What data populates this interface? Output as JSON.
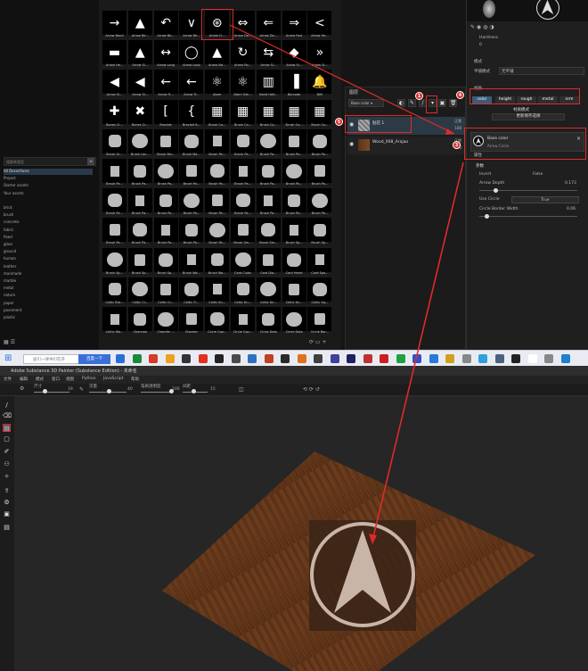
{
  "shelf": {
    "search_placeholder": "搜索库类型",
    "categories": [
      "All Decorfaces",
      "Project",
      "Starter assets",
      "Your assets",
      "",
      "brick",
      "brush",
      "concrete",
      "fabric",
      "fixed",
      "glass",
      "ground",
      "human",
      "leather",
      "manmade",
      "marble",
      "metal",
      "nature",
      "paper",
      "pavement",
      "plastic"
    ]
  },
  "grid": {
    "rows": [
      [
        "Arrow Band",
        "Arrow Be...",
        "Arrow Be...",
        "Arrow Be...",
        "Arrow Ci...",
        "Arrow Do...",
        "Arrow Do...",
        "Arrow Fast",
        "Arrow He..."
      ],
      [
        "Arrow He...",
        "Arrow Si...",
        "Arrow Long",
        "Arrow Loop",
        "Arrow Ne...",
        "Arrow Ro...",
        "Arrow Si...",
        "Arrow Si...",
        "Arrow Si..."
      ],
      [
        "Arrow Si...",
        "Arrow Si...",
        "Arrow Tr...",
        "Arrow Tr...",
        "Atom",
        "Atom Sim...",
        "Band Half...",
        "Barcode",
        "Bell"
      ],
      [
        "Bones Cr...",
        "Bones Cr...",
        "Bracket",
        "Bracket B...",
        "Brush Co...",
        "Brush Co...",
        "Brush Co...",
        "Brush Co...",
        "Brush Co..."
      ],
      [
        "Brush Gr...",
        "Brush Lon...",
        "Brush Ma...",
        "Brush Ma...",
        "Brush Pa...",
        "Brush Pa...",
        "Brush Pa...",
        "Brush Pa...",
        "Brush Pa..."
      ],
      [
        "Brush Pa...",
        "Brush Pa...",
        "Brush Pa...",
        "Brush Pa...",
        "Brush Pa...",
        "Brush Pa...",
        "Brush Pa...",
        "Brush Pa...",
        "Brush Pa..."
      ],
      [
        "Brush Pa...",
        "Brush Pa...",
        "Brush Pa...",
        "Brush Pa...",
        "Brush Pa...",
        "Brush Pa...",
        "Brush Pa...",
        "Brush Pa...",
        "Brush Pa..."
      ],
      [
        "Brush Pa...",
        "Brush Pa...",
        "Brush Pa...",
        "Brush Pa...",
        "Brush Pa...",
        "Brush Sm...",
        "Brush Sm...",
        "Brush Sp...",
        "Brush Sp..."
      ],
      [
        "Brush Sp...",
        "Brush Sp...",
        "Brush Sp...",
        "Brush Wa...",
        "Brush Wa...",
        "Card Clubs",
        "Card Dia...",
        "Card Heart",
        "Card Spa..."
      ],
      [
        "Celtic Bra...",
        "Celtic Cr...",
        "Celtic Cr...",
        "Celtic Fl...",
        "Celtic Kn...",
        "Celtic Kn...",
        "Celtic Kn...",
        "Celtic Kn...",
        "Celtic Sq..."
      ],
      [
        "Celtic Wa...",
        "Charcoal",
        "Chamfer ...",
        "Checker",
        "Circle Cop...",
        "Circle Cop...",
        "Circle Dots",
        "Circle Dots",
        "Circle Bor..."
      ]
    ]
  },
  "layers": {
    "title": "图层",
    "channel_dropdown": "Base color",
    "rows": [
      {
        "name": "贴花 1",
        "blend": "正常",
        "opacity": "100"
      },
      {
        "name": "Wood_008_Arajao",
        "blend": "正常",
        "opacity": "100"
      }
    ]
  },
  "properties": {
    "hardness_label": "Hardness",
    "hardness_value": "0",
    "mode_label": "模式",
    "mode_field": "平铺模式",
    "mode_value": "无平铺",
    "material_label": "材质",
    "channels": [
      "color",
      "height",
      "rough",
      "metal",
      "nrm"
    ],
    "material_mode_label": "材质模式",
    "material_mode_btn": "更新保存选择",
    "base_color_title": "Base color",
    "base_color_sub": "Arrow Circle",
    "attr_title": "属性",
    "params_title": "参数",
    "invert_label": "Invert",
    "invert_value": "False",
    "arrow_depth_label": "Arrow Depth",
    "arrow_depth_value": "0.173",
    "use_circle_label": "Use Circle",
    "use_circle_value": "True",
    "circle_border_label": "Circle Border Width",
    "circle_border_value": "0.06"
  },
  "taskbar": {
    "search_placeholder": "居引一律书引在开",
    "search_button": "百度一下"
  },
  "app": {
    "title": "Adobe Substance 3D Painter (Substance Edition) - 未命名",
    "menu": [
      "文件",
      "编辑",
      "模式",
      "窗口",
      "视图",
      "Python",
      "JavaScript",
      "帮助"
    ],
    "toolbar": {
      "size_label": "尺寸",
      "size_value": "19",
      "flow_label": "流量",
      "flow_value": "40",
      "stroke_opacity_label": "笔刷透明度",
      "stroke_opacity_value": "100",
      "spacing_label": "间距",
      "spacing_value": "15"
    }
  },
  "badges": [
    "1",
    "2",
    "3",
    "4",
    "5"
  ],
  "colors": {
    "accent_red": "#e02a2a",
    "selection_blue": "#3a6fd8"
  }
}
